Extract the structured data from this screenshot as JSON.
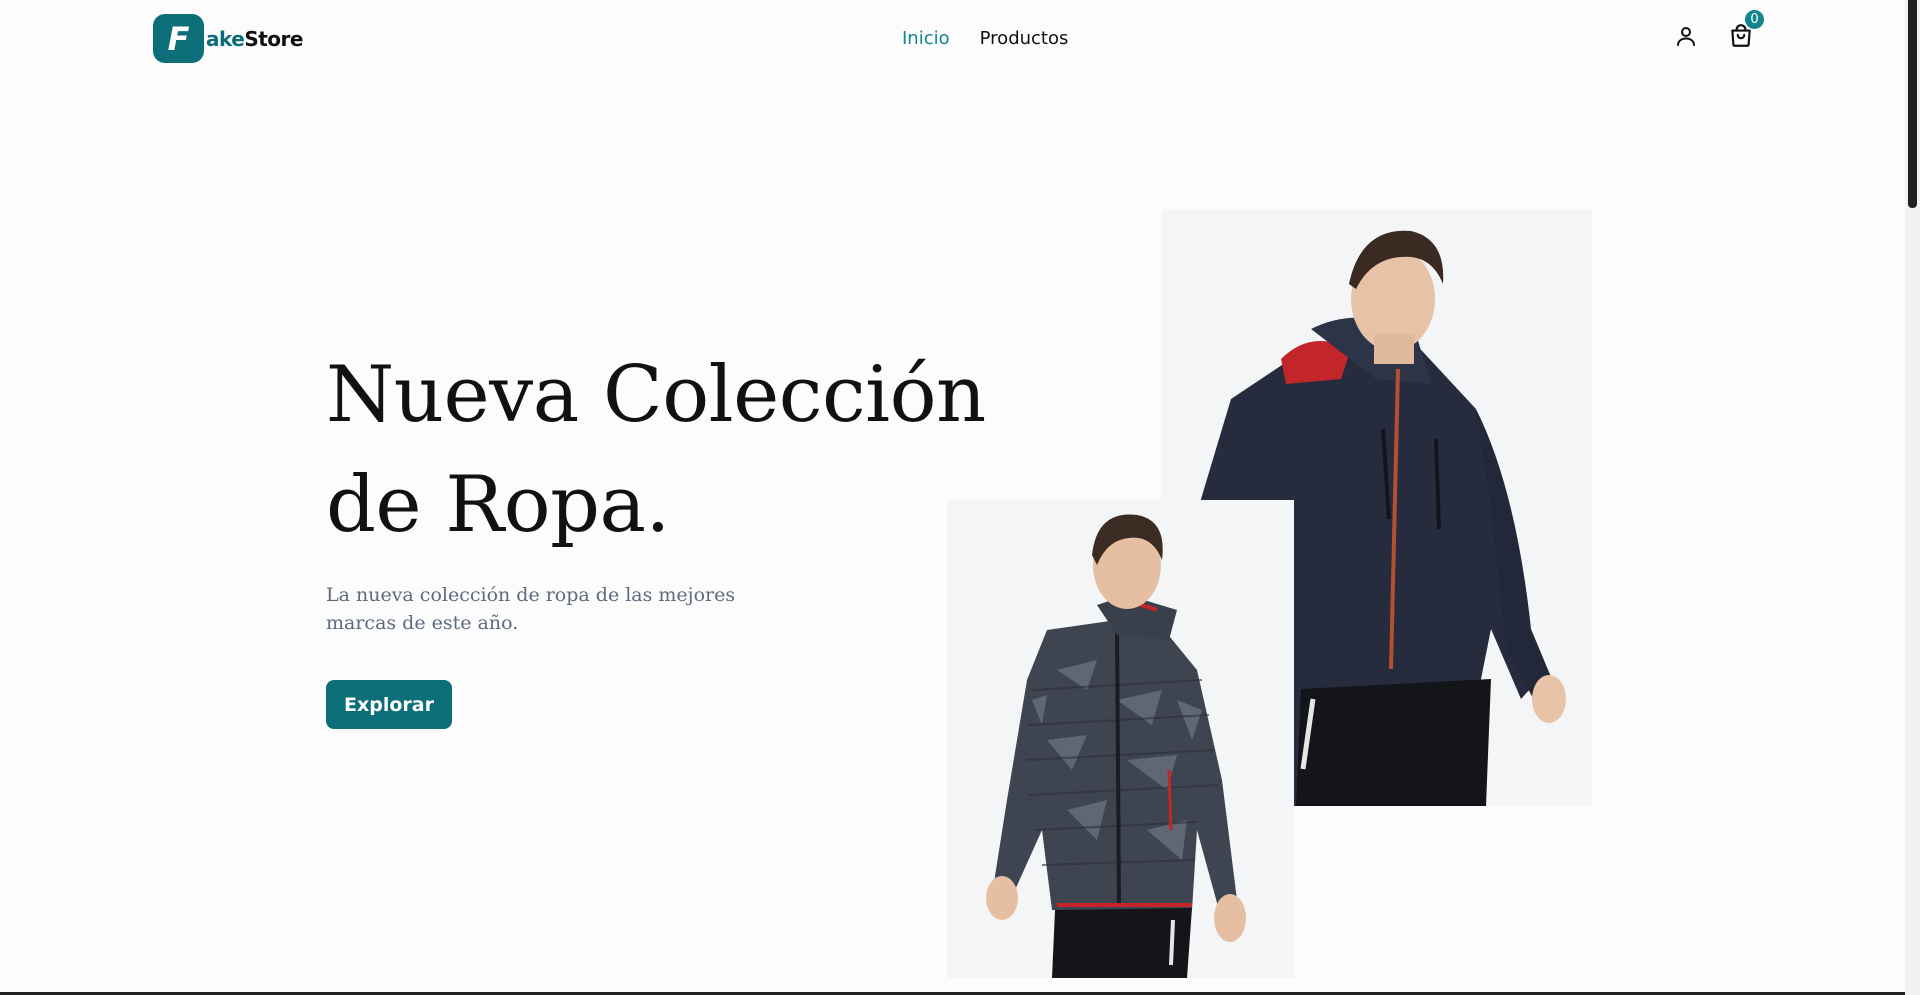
{
  "header": {
    "logo": {
      "mark": "F",
      "accent": "ake",
      "rest": "Store"
    },
    "nav": [
      {
        "label": "Inicio",
        "active": true
      },
      {
        "label": "Productos",
        "active": false
      }
    ],
    "user_icon": "user-icon",
    "cart_icon": "shopping-bag-icon",
    "cart_count": "0"
  },
  "hero": {
    "title_line1": "Nueva Colección",
    "title_line2": "de Ropa.",
    "subtitle": "La nueva colección de ropa de las mejores marcas de este año.",
    "button_label": "Explorar"
  },
  "colors": {
    "brand": "#0b6e79",
    "nav_active": "#13858f",
    "subtitle": "#5c6b7e",
    "background": "#fcfcfc"
  }
}
